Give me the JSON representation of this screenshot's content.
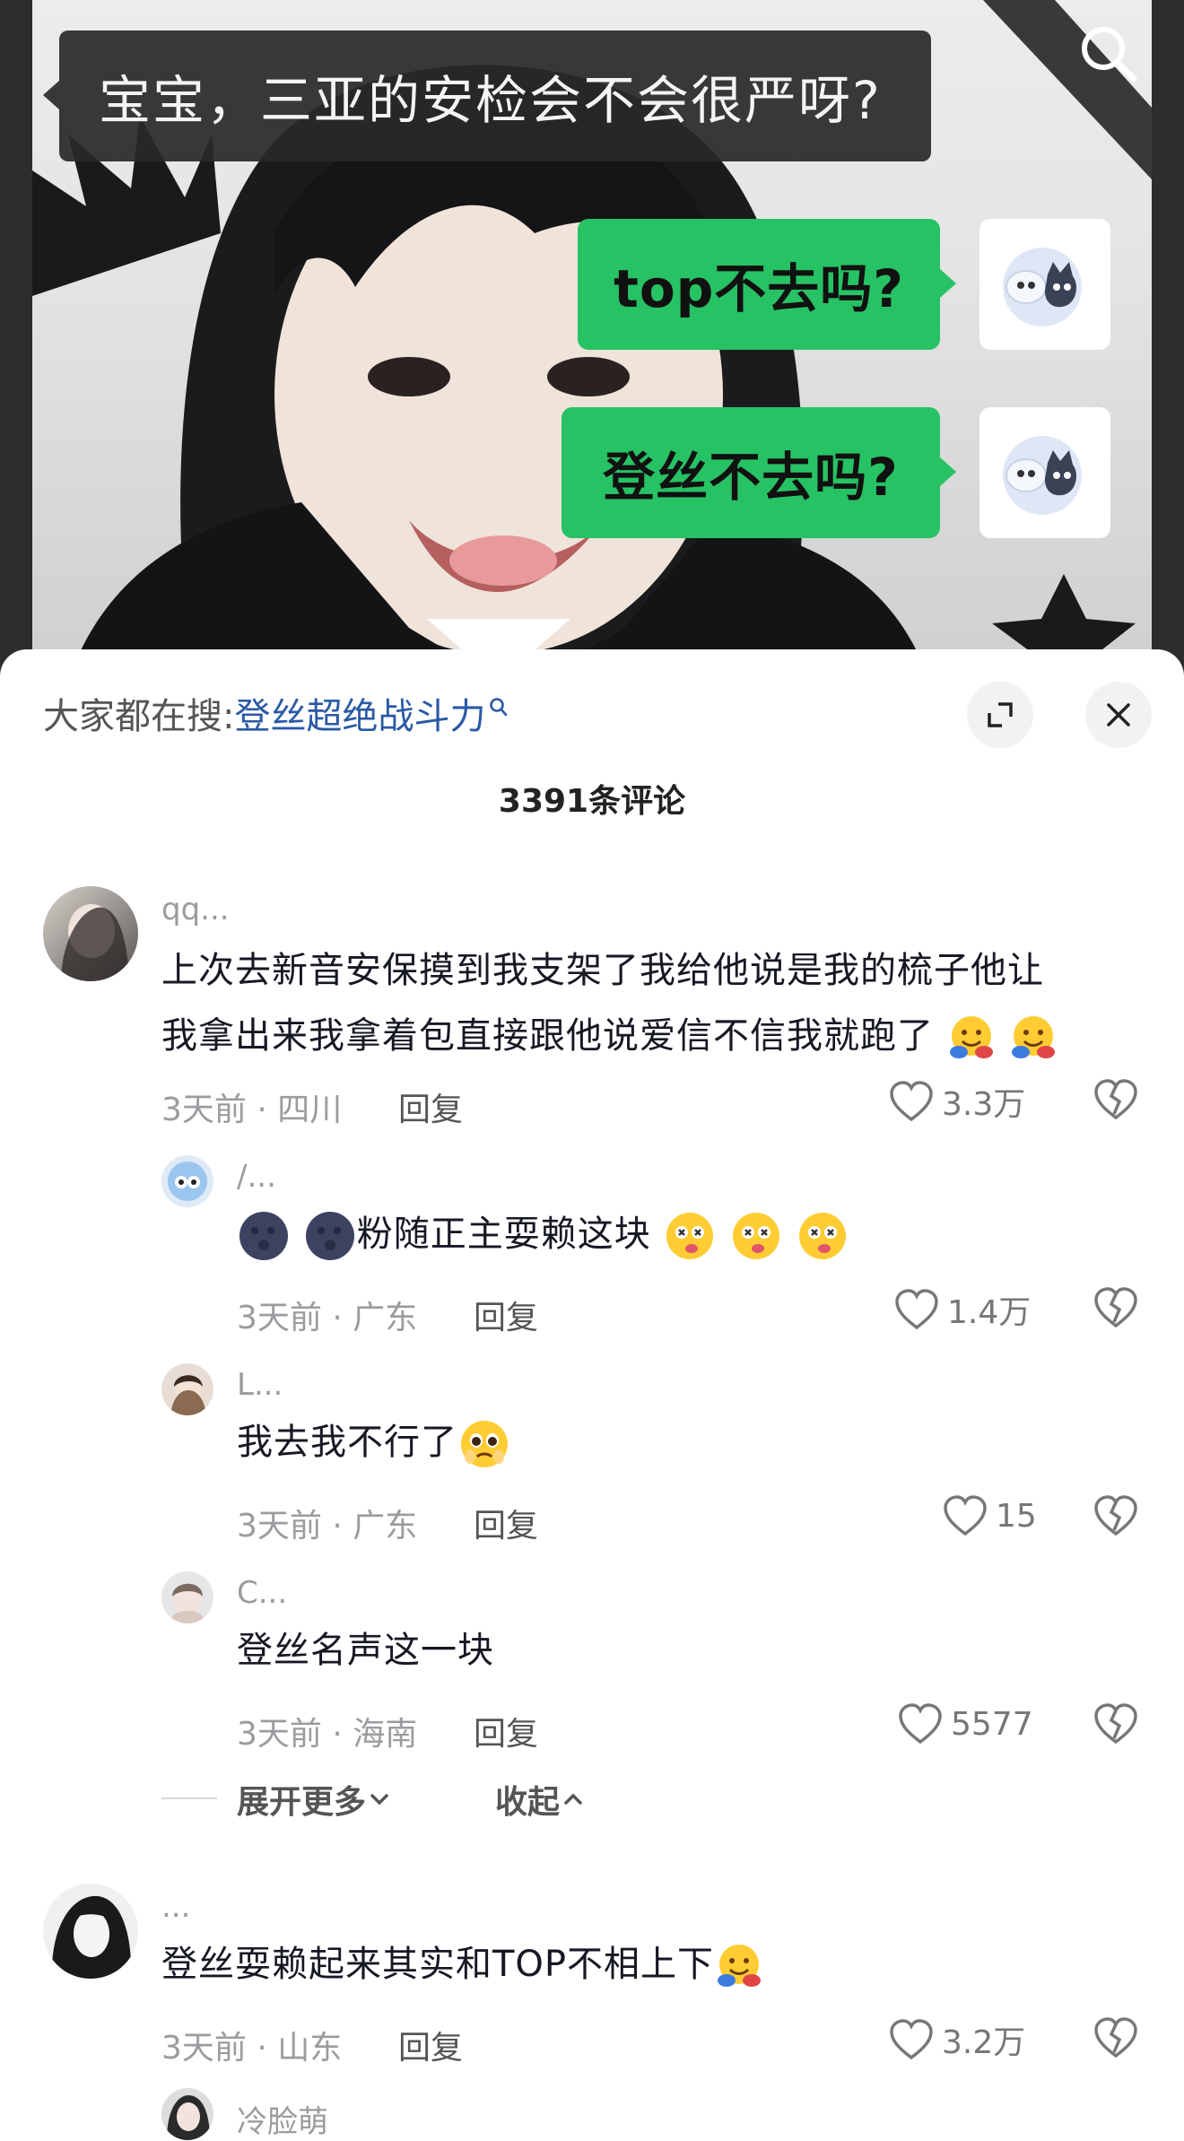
{
  "video": {
    "caption": "宝宝，三亚的安检会不会很严呀?",
    "bubbles": [
      "top不去吗?",
      "登丝不去吗?"
    ]
  },
  "sheet": {
    "trending_prefix": "大家都在搜:",
    "trending_keyword": "登丝超绝战斗力",
    "comment_count": "3391",
    "comment_count_suffix": "条评论"
  },
  "comments": [
    {
      "username": "qq...",
      "text_line1": "上次去新音安保摸到我支架了我给他说是我的梳子他让",
      "text_line2": "我拿出来我拿着包直接跟他说爱信不信我就跑了",
      "time": "3天前 · 四川",
      "reply": "回复",
      "likes": "3.3万"
    },
    {
      "username": "/...",
      "text": "粉随正主耍赖这块",
      "time": "3天前 · 广东",
      "reply": "回复",
      "likes": "1.4万"
    },
    {
      "username": "L...",
      "text": "我去我不行了",
      "time": "3天前 · 广东",
      "reply": "回复",
      "likes": "15"
    },
    {
      "username": "C...",
      "text": "登丝名声这一块",
      "time": "3天前 · 海南",
      "reply": "回复",
      "likes": "5577"
    },
    {
      "username": "...",
      "text": "登丝耍赖起来其实和TOP不相上下",
      "time": "3天前 · 山东",
      "reply": "回复",
      "likes": "3.2万"
    },
    {
      "username": "冷脸萌"
    }
  ],
  "thread_controls": {
    "expand": "展开更多",
    "collapse": "收起"
  },
  "colors": {
    "bubble_green": "#27c264",
    "keyword_blue": "#2a59a5",
    "muted_gray": "#9b9ba0"
  }
}
